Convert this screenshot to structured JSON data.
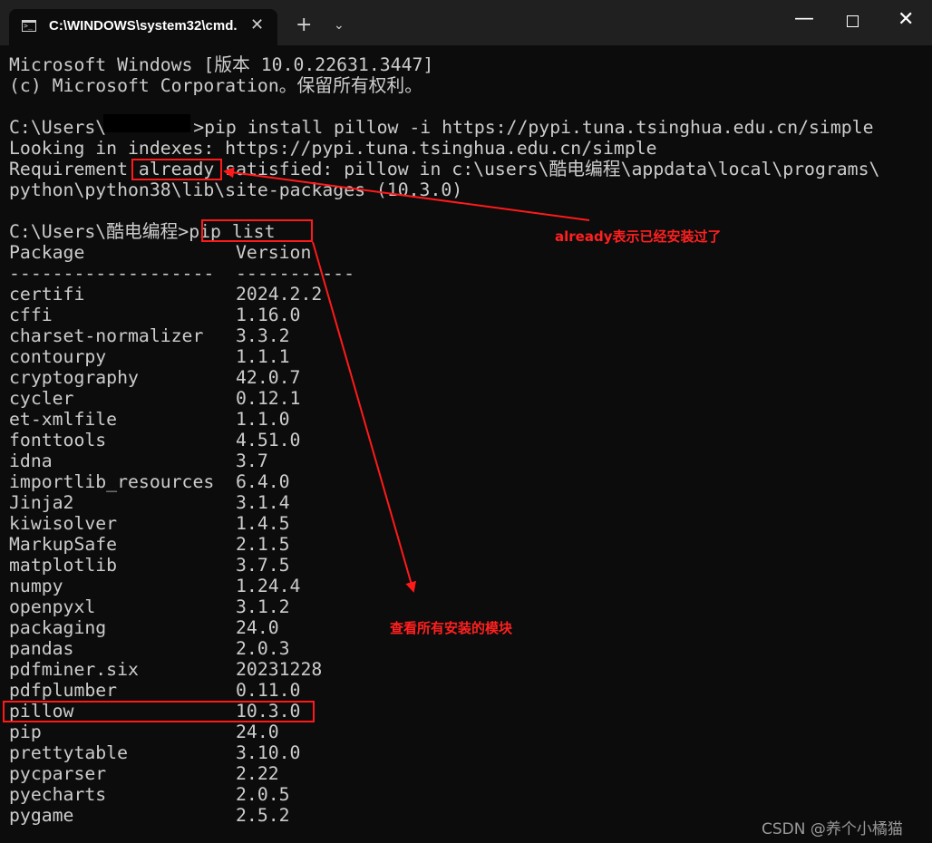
{
  "window": {
    "tab_title": "C:\\WINDOWS\\system32\\cmd.",
    "new_tab_symbol": "+",
    "dropdown_symbol": "⌄",
    "close_tab_symbol": "✕",
    "minimize_symbol": "—",
    "close_symbol": "✕"
  },
  "header_lines": [
    "Microsoft Windows [版本 10.0.22631.3447]",
    "(c) Microsoft Corporation。保留所有权利。"
  ],
  "install": {
    "prompt_prefix": "C:\\Users\\",
    "prompt_suffix": ">pip install pillow -i https://pypi.tuna.tsinghua.edu.cn/simple",
    "looking": "Looking in indexes: https://pypi.tuna.tsinghua.edu.cn/simple",
    "req_line1": "Requirement already satisfied: pillow in c:\\users\\酷电编程\\appdata\\local\\programs\\",
    "req_line2": "python\\python38\\lib\\site-packages (10.3.0)"
  },
  "list_cmd": {
    "prompt": "C:\\Users\\酷电编程>",
    "command": "pip list"
  },
  "table": {
    "header_package": "Package",
    "header_version": "Version",
    "sep_package": "-------------------",
    "sep_version": "-----------",
    "rows": [
      {
        "name": "certifi",
        "version": "2024.2.2"
      },
      {
        "name": "cffi",
        "version": "1.16.0"
      },
      {
        "name": "charset-normalizer",
        "version": "3.3.2"
      },
      {
        "name": "contourpy",
        "version": "1.1.1"
      },
      {
        "name": "cryptography",
        "version": "42.0.7"
      },
      {
        "name": "cycler",
        "version": "0.12.1"
      },
      {
        "name": "et-xmlfile",
        "version": "1.1.0"
      },
      {
        "name": "fonttools",
        "version": "4.51.0"
      },
      {
        "name": "idna",
        "version": "3.7"
      },
      {
        "name": "importlib_resources",
        "version": "6.4.0"
      },
      {
        "name": "Jinja2",
        "version": "3.1.4"
      },
      {
        "name": "kiwisolver",
        "version": "1.4.5"
      },
      {
        "name": "MarkupSafe",
        "version": "2.1.5"
      },
      {
        "name": "matplotlib",
        "version": "3.7.5"
      },
      {
        "name": "numpy",
        "version": "1.24.4"
      },
      {
        "name": "openpyxl",
        "version": "3.1.2"
      },
      {
        "name": "packaging",
        "version": "24.0"
      },
      {
        "name": "pandas",
        "version": "2.0.3"
      },
      {
        "name": "pdfminer.six",
        "version": "20231228"
      },
      {
        "name": "pdfplumber",
        "version": "0.11.0"
      },
      {
        "name": "pillow",
        "version": "10.3.0"
      },
      {
        "name": "pip",
        "version": "24.0"
      },
      {
        "name": "prettytable",
        "version": "3.10.0"
      },
      {
        "name": "pycparser",
        "version": "2.22"
      },
      {
        "name": "pyecharts",
        "version": "2.0.5"
      },
      {
        "name": "pygame",
        "version": "2.5.2"
      }
    ]
  },
  "annotations": {
    "already_note": "already表示已经安装过了",
    "list_note": "查看所有安装的模块"
  },
  "watermark": "CSDN @养个小橘猫",
  "colors": {
    "terminal_bg": "#0c0c0c",
    "terminal_text": "#cccccc",
    "titlebar_bg": "#202020",
    "annotation_red": "#ff1a1a"
  }
}
